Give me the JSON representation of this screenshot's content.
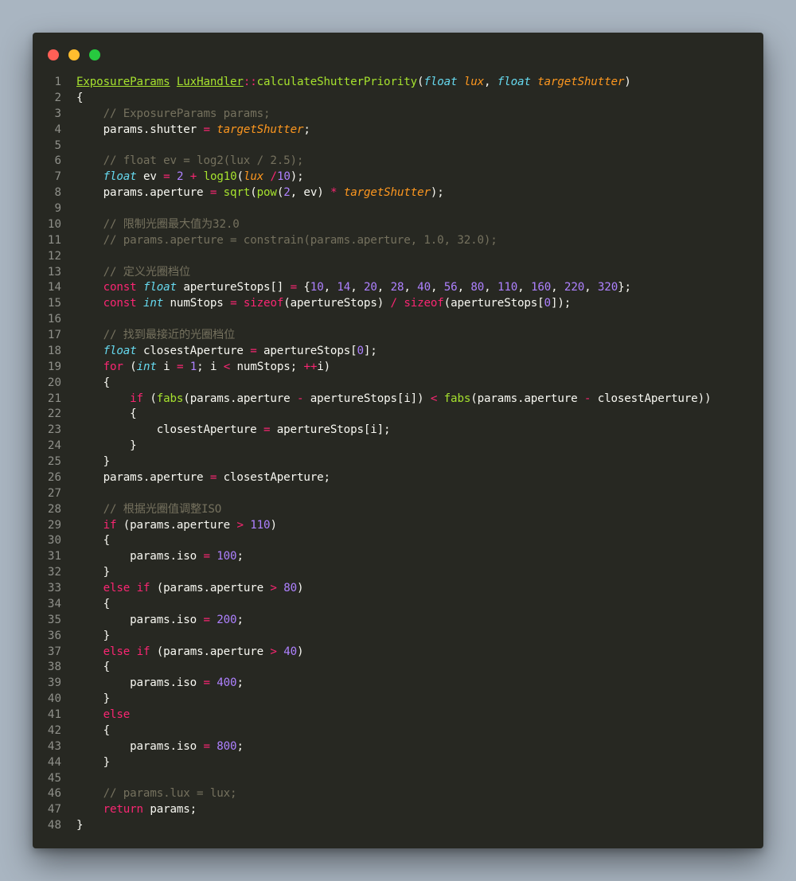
{
  "window": {
    "controls": [
      "close",
      "minimize",
      "maximize"
    ],
    "colors": {
      "background": "#272822",
      "close": "#ff5f56",
      "minimize": "#ffbd2e",
      "maximize": "#27c93f"
    }
  },
  "code": {
    "language": "C++",
    "lines": [
      {
        "n": "1",
        "tokens": [
          [
            "class",
            "ExposureParams"
          ],
          [
            "plain",
            " "
          ],
          [
            "class",
            "LuxHandler"
          ],
          [
            "op",
            "::"
          ],
          [
            "func",
            "calculateShutterPriority"
          ],
          [
            "plain",
            "("
          ],
          [
            "type",
            "float"
          ],
          [
            "plain",
            " "
          ],
          [
            "param",
            "lux"
          ],
          [
            "plain",
            ", "
          ],
          [
            "type",
            "float"
          ],
          [
            "plain",
            " "
          ],
          [
            "param",
            "targetShutter"
          ],
          [
            "plain",
            ")"
          ]
        ]
      },
      {
        "n": "2",
        "tokens": [
          [
            "plain",
            "{"
          ]
        ]
      },
      {
        "n": "3",
        "tokens": [
          [
            "plain",
            "    "
          ],
          [
            "comment",
            "// ExposureParams params;"
          ]
        ]
      },
      {
        "n": "4",
        "tokens": [
          [
            "plain",
            "    params.shutter "
          ],
          [
            "op",
            "="
          ],
          [
            "plain",
            " "
          ],
          [
            "param",
            "targetShutter"
          ],
          [
            "plain",
            ";"
          ]
        ]
      },
      {
        "n": "5",
        "tokens": []
      },
      {
        "n": "6",
        "tokens": [
          [
            "plain",
            "    "
          ],
          [
            "comment",
            "// float ev = log2(lux / 2.5);"
          ]
        ]
      },
      {
        "n": "7",
        "tokens": [
          [
            "plain",
            "    "
          ],
          [
            "type",
            "float"
          ],
          [
            "plain",
            " ev "
          ],
          [
            "op",
            "="
          ],
          [
            "plain",
            " "
          ],
          [
            "number",
            "2"
          ],
          [
            "plain",
            " "
          ],
          [
            "op",
            "+"
          ],
          [
            "plain",
            " "
          ],
          [
            "func",
            "log10"
          ],
          [
            "plain",
            "("
          ],
          [
            "param",
            "lux"
          ],
          [
            "plain",
            " "
          ],
          [
            "op",
            "/"
          ],
          [
            "number",
            "10"
          ],
          [
            "plain",
            ");"
          ]
        ]
      },
      {
        "n": "8",
        "tokens": [
          [
            "plain",
            "    params.aperture "
          ],
          [
            "op",
            "="
          ],
          [
            "plain",
            " "
          ],
          [
            "func",
            "sqrt"
          ],
          [
            "plain",
            "("
          ],
          [
            "func",
            "pow"
          ],
          [
            "plain",
            "("
          ],
          [
            "number",
            "2"
          ],
          [
            "plain",
            ", ev) "
          ],
          [
            "op",
            "*"
          ],
          [
            "plain",
            " "
          ],
          [
            "param",
            "targetShutter"
          ],
          [
            "plain",
            ");"
          ]
        ]
      },
      {
        "n": "9",
        "tokens": []
      },
      {
        "n": "10",
        "tokens": [
          [
            "plain",
            "    "
          ],
          [
            "comment",
            "// 限制光圈最大值为32.0"
          ]
        ]
      },
      {
        "n": "11",
        "tokens": [
          [
            "plain",
            "    "
          ],
          [
            "comment",
            "// params.aperture = constrain(params.aperture, 1.0, 32.0);"
          ]
        ]
      },
      {
        "n": "12",
        "tokens": []
      },
      {
        "n": "13",
        "tokens": [
          [
            "plain",
            "    "
          ],
          [
            "comment",
            "// 定义光圈档位"
          ]
        ]
      },
      {
        "n": "14",
        "tokens": [
          [
            "plain",
            "    "
          ],
          [
            "keyword",
            "const"
          ],
          [
            "plain",
            " "
          ],
          [
            "type",
            "float"
          ],
          [
            "plain",
            " apertureStops[] "
          ],
          [
            "op",
            "="
          ],
          [
            "plain",
            " {"
          ],
          [
            "number",
            "10"
          ],
          [
            "plain",
            ", "
          ],
          [
            "number",
            "14"
          ],
          [
            "plain",
            ", "
          ],
          [
            "number",
            "20"
          ],
          [
            "plain",
            ", "
          ],
          [
            "number",
            "28"
          ],
          [
            "plain",
            ", "
          ],
          [
            "number",
            "40"
          ],
          [
            "plain",
            ", "
          ],
          [
            "number",
            "56"
          ],
          [
            "plain",
            ", "
          ],
          [
            "number",
            "80"
          ],
          [
            "plain",
            ", "
          ],
          [
            "number",
            "110"
          ],
          [
            "plain",
            ", "
          ],
          [
            "number",
            "160"
          ],
          [
            "plain",
            ", "
          ],
          [
            "number",
            "220"
          ],
          [
            "plain",
            ", "
          ],
          [
            "number",
            "320"
          ],
          [
            "plain",
            "};"
          ]
        ]
      },
      {
        "n": "15",
        "tokens": [
          [
            "plain",
            "    "
          ],
          [
            "keyword",
            "const"
          ],
          [
            "plain",
            " "
          ],
          [
            "type",
            "int"
          ],
          [
            "plain",
            " numStops "
          ],
          [
            "op",
            "="
          ],
          [
            "plain",
            " "
          ],
          [
            "keyword",
            "sizeof"
          ],
          [
            "plain",
            "(apertureStops) "
          ],
          [
            "op",
            "/"
          ],
          [
            "plain",
            " "
          ],
          [
            "keyword",
            "sizeof"
          ],
          [
            "plain",
            "(apertureStops["
          ],
          [
            "number",
            "0"
          ],
          [
            "plain",
            "]);"
          ]
        ]
      },
      {
        "n": "16",
        "tokens": []
      },
      {
        "n": "17",
        "tokens": [
          [
            "plain",
            "    "
          ],
          [
            "comment",
            "// 找到最接近的光圈档位"
          ]
        ]
      },
      {
        "n": "18",
        "tokens": [
          [
            "plain",
            "    "
          ],
          [
            "type",
            "float"
          ],
          [
            "plain",
            " closestAperture "
          ],
          [
            "op",
            "="
          ],
          [
            "plain",
            " apertureStops["
          ],
          [
            "number",
            "0"
          ],
          [
            "plain",
            "];"
          ]
        ]
      },
      {
        "n": "19",
        "tokens": [
          [
            "plain",
            "    "
          ],
          [
            "keyword",
            "for"
          ],
          [
            "plain",
            " ("
          ],
          [
            "type",
            "int"
          ],
          [
            "plain",
            " i "
          ],
          [
            "op",
            "="
          ],
          [
            "plain",
            " "
          ],
          [
            "number",
            "1"
          ],
          [
            "plain",
            "; i "
          ],
          [
            "op",
            "<"
          ],
          [
            "plain",
            " numStops; "
          ],
          [
            "op",
            "++"
          ],
          [
            "plain",
            "i)"
          ]
        ]
      },
      {
        "n": "20",
        "tokens": [
          [
            "plain",
            "    {"
          ]
        ]
      },
      {
        "n": "21",
        "tokens": [
          [
            "plain",
            "        "
          ],
          [
            "keyword",
            "if"
          ],
          [
            "plain",
            " ("
          ],
          [
            "func",
            "fabs"
          ],
          [
            "plain",
            "(params.aperture "
          ],
          [
            "op",
            "-"
          ],
          [
            "plain",
            " apertureStops[i]) "
          ],
          [
            "op",
            "<"
          ],
          [
            "plain",
            " "
          ],
          [
            "func",
            "fabs"
          ],
          [
            "plain",
            "(params.aperture "
          ],
          [
            "op",
            "-"
          ],
          [
            "plain",
            " closestAperture))"
          ]
        ]
      },
      {
        "n": "22",
        "tokens": [
          [
            "plain",
            "        {"
          ]
        ]
      },
      {
        "n": "23",
        "tokens": [
          [
            "plain",
            "            closestAperture "
          ],
          [
            "op",
            "="
          ],
          [
            "plain",
            " apertureStops[i];"
          ]
        ]
      },
      {
        "n": "24",
        "tokens": [
          [
            "plain",
            "        }"
          ]
        ]
      },
      {
        "n": "25",
        "tokens": [
          [
            "plain",
            "    }"
          ]
        ]
      },
      {
        "n": "26",
        "tokens": [
          [
            "plain",
            "    params.aperture "
          ],
          [
            "op",
            "="
          ],
          [
            "plain",
            " closestAperture;"
          ]
        ]
      },
      {
        "n": "27",
        "tokens": []
      },
      {
        "n": "28",
        "tokens": [
          [
            "plain",
            "    "
          ],
          [
            "comment",
            "// 根据光圈值调整ISO"
          ]
        ]
      },
      {
        "n": "29",
        "tokens": [
          [
            "plain",
            "    "
          ],
          [
            "keyword",
            "if"
          ],
          [
            "plain",
            " (params.aperture "
          ],
          [
            "op",
            ">"
          ],
          [
            "plain",
            " "
          ],
          [
            "number",
            "110"
          ],
          [
            "plain",
            ")"
          ]
        ]
      },
      {
        "n": "30",
        "tokens": [
          [
            "plain",
            "    {"
          ]
        ]
      },
      {
        "n": "31",
        "tokens": [
          [
            "plain",
            "        params.iso "
          ],
          [
            "op",
            "="
          ],
          [
            "plain",
            " "
          ],
          [
            "number",
            "100"
          ],
          [
            "plain",
            ";"
          ]
        ]
      },
      {
        "n": "32",
        "tokens": [
          [
            "plain",
            "    }"
          ]
        ]
      },
      {
        "n": "33",
        "tokens": [
          [
            "plain",
            "    "
          ],
          [
            "keyword",
            "else"
          ],
          [
            "plain",
            " "
          ],
          [
            "keyword",
            "if"
          ],
          [
            "plain",
            " (params.aperture "
          ],
          [
            "op",
            ">"
          ],
          [
            "plain",
            " "
          ],
          [
            "number",
            "80"
          ],
          [
            "plain",
            ")"
          ]
        ]
      },
      {
        "n": "34",
        "tokens": [
          [
            "plain",
            "    {"
          ]
        ]
      },
      {
        "n": "35",
        "tokens": [
          [
            "plain",
            "        params.iso "
          ],
          [
            "op",
            "="
          ],
          [
            "plain",
            " "
          ],
          [
            "number",
            "200"
          ],
          [
            "plain",
            ";"
          ]
        ]
      },
      {
        "n": "36",
        "tokens": [
          [
            "plain",
            "    }"
          ]
        ]
      },
      {
        "n": "37",
        "tokens": [
          [
            "plain",
            "    "
          ],
          [
            "keyword",
            "else"
          ],
          [
            "plain",
            " "
          ],
          [
            "keyword",
            "if"
          ],
          [
            "plain",
            " (params.aperture "
          ],
          [
            "op",
            ">"
          ],
          [
            "plain",
            " "
          ],
          [
            "number",
            "40"
          ],
          [
            "plain",
            ")"
          ]
        ]
      },
      {
        "n": "38",
        "tokens": [
          [
            "plain",
            "    {"
          ]
        ]
      },
      {
        "n": "39",
        "tokens": [
          [
            "plain",
            "        params.iso "
          ],
          [
            "op",
            "="
          ],
          [
            "plain",
            " "
          ],
          [
            "number",
            "400"
          ],
          [
            "plain",
            ";"
          ]
        ]
      },
      {
        "n": "40",
        "tokens": [
          [
            "plain",
            "    }"
          ]
        ]
      },
      {
        "n": "41",
        "tokens": [
          [
            "plain",
            "    "
          ],
          [
            "keyword",
            "else"
          ]
        ]
      },
      {
        "n": "42",
        "tokens": [
          [
            "plain",
            "    {"
          ]
        ]
      },
      {
        "n": "43",
        "tokens": [
          [
            "plain",
            "        params.iso "
          ],
          [
            "op",
            "="
          ],
          [
            "plain",
            " "
          ],
          [
            "number",
            "800"
          ],
          [
            "plain",
            ";"
          ]
        ]
      },
      {
        "n": "44",
        "tokens": [
          [
            "plain",
            "    }"
          ]
        ]
      },
      {
        "n": "45",
        "tokens": []
      },
      {
        "n": "46",
        "tokens": [
          [
            "plain",
            "    "
          ],
          [
            "comment",
            "// params.lux = lux;"
          ]
        ]
      },
      {
        "n": "47",
        "tokens": [
          [
            "plain",
            "    "
          ],
          [
            "keyword",
            "return"
          ],
          [
            "plain",
            " params;"
          ]
        ]
      },
      {
        "n": "48",
        "tokens": [
          [
            "plain",
            "}"
          ]
        ]
      }
    ]
  }
}
